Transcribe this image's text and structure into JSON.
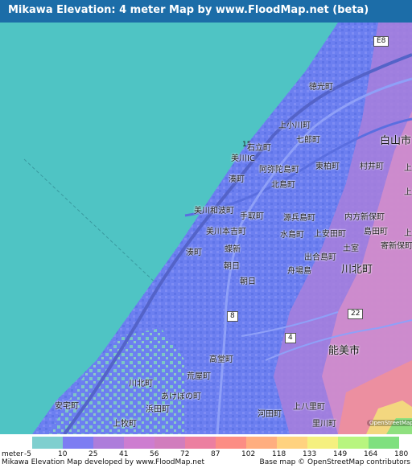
{
  "title": "Mikawa Elevation: 4 meter Map by www.FloodMap.net (beta)",
  "map": {
    "place_labels": {
      "l01": "徳光町",
      "l02": "上小川町",
      "l03": "七郎町",
      "l04": "白山市",
      "l05": "石立町",
      "l06": "美川IC",
      "l07": "阿弥陀島町",
      "l08": "東柏町",
      "l09": "村井町",
      "l10": "湊町",
      "l11": "北島町",
      "l12": "美川和波町",
      "l13": "手取町",
      "l14": "源兵島町",
      "l15": "内方新保町",
      "l16": "美川本吉町",
      "l17": "水島町",
      "l18": "上安田町",
      "l19": "島田町",
      "l20": "土室",
      "l21": "寄新保町",
      "l22": "湊町",
      "l23": "蝶新",
      "l24": "朝日",
      "l25": "出合島町",
      "l26": "舟場島",
      "l27": "川北町",
      "l28": "能美市",
      "l29": "高堂町",
      "l30": "荒屋町",
      "l31": "川北町",
      "l32": "あけぼの町",
      "l33": "浜田町",
      "l34": "朝日",
      "l35": "安宅町",
      "l36": "上八里町",
      "l37": "河田町",
      "l38": "里川町",
      "l39": "上",
      "l40": "上牧町",
      "l41": "上",
      "l42": "上"
    },
    "road_shields": {
      "e8": "E8",
      "r8": "8",
      "r22": "22",
      "r4": "4",
      "r15": "15"
    },
    "osm_badge": "OpenStreetMap"
  },
  "legend": {
    "unit": "meter",
    "ticks": [
      "-5",
      "10",
      "25",
      "41",
      "56",
      "72",
      "87",
      "102",
      "118",
      "133",
      "149",
      "164",
      "180"
    ],
    "colors": [
      "#7fcfcf",
      "#7d7df2",
      "#ad7ddb",
      "#cd7dd0",
      "#d17dbd",
      "#ec7fa0",
      "#fc8d84",
      "#ffae7f",
      "#ffd27f",
      "#f5f07f",
      "#b8f57f",
      "#7fe07f"
    ],
    "credit_left": "Mikawa Elevation Map developed by www.FloodMap.net",
    "credit_right": "Base map © OpenStreetMap contributors"
  },
  "colors": {
    "sea": "#4fc4c4",
    "low_land": "#6a7df0",
    "mid_land": "#b07dd8",
    "high_land": "#e88ab0",
    "title_bar": "#1c6da8"
  }
}
